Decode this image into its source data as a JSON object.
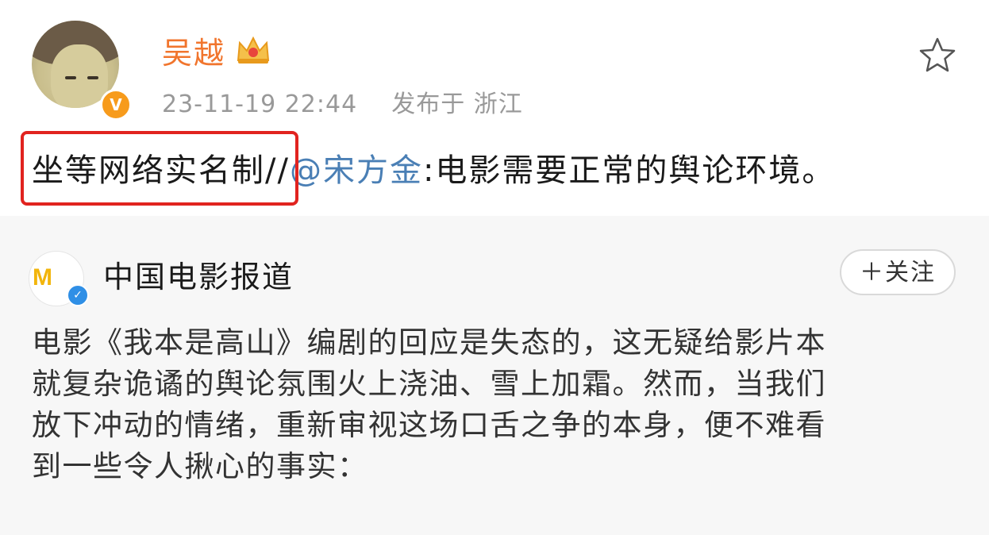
{
  "post": {
    "author": "吴越",
    "crown_icon": "crown-badge-icon",
    "verified_icon": "orange-verified-icon",
    "timestamp": "23-11-19 22:44",
    "location": "发布于 浙江",
    "text_highlight": "坐等网络实名制",
    "text_sep": "//",
    "mention": "@宋方金",
    "text_rest": ":电影需要正常的舆论环境。",
    "favorite_icon": "star-outline-icon",
    "highlight_color": "#e1231f",
    "author_color": "#f1752d",
    "mention_color": "#4a7fb5"
  },
  "repost": {
    "author": "中国电影报道",
    "verified_icon": "blue-verified-icon",
    "follow_label": "＋关注",
    "lines": [
      "电影《我本是高山》编剧的回应是失态的，这无疑给影片本",
      "就复杂诡谲的舆论氛围火上浇油、雪上加霜。然而，当我们",
      "放下冲动的情绪，重新审视这场口舌之争的本身，便不难看",
      "到一些令人揪心的事实："
    ]
  }
}
